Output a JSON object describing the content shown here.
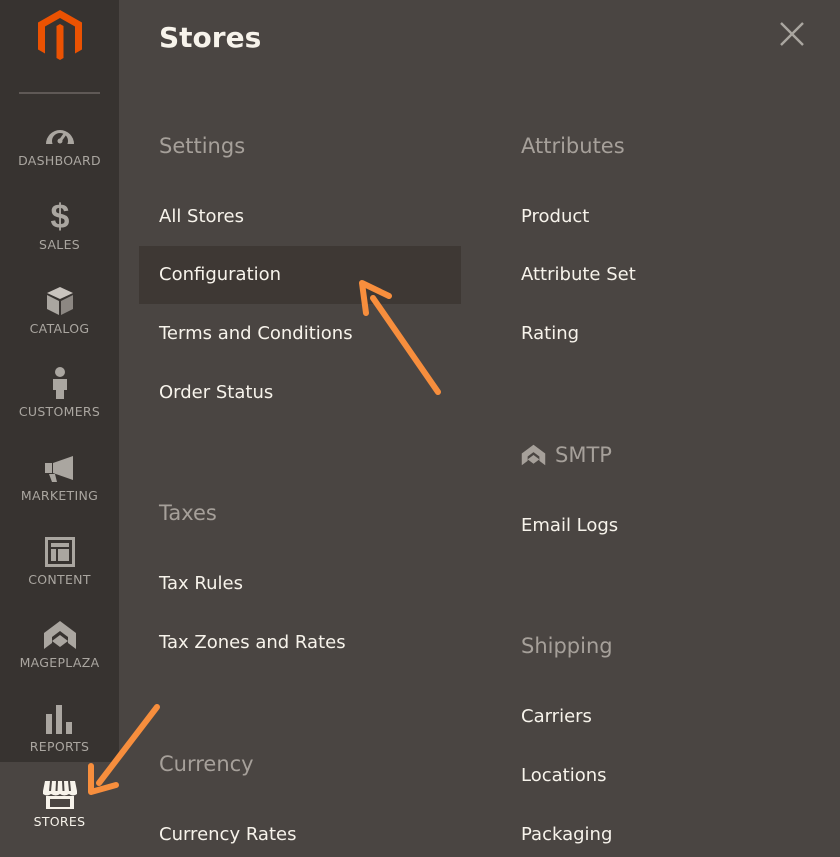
{
  "sidebar": {
    "logo": "magento-logo",
    "items": [
      {
        "label": "DASHBOARD",
        "icon": "gauge-icon"
      },
      {
        "label": "SALES",
        "icon": "dollar-icon"
      },
      {
        "label": "CATALOG",
        "icon": "box-icon"
      },
      {
        "label": "CUSTOMERS",
        "icon": "person-icon"
      },
      {
        "label": "MARKETING",
        "icon": "megaphone-icon"
      },
      {
        "label": "CONTENT",
        "icon": "layout-icon"
      },
      {
        "label": "MAGEPLAZA",
        "icon": "mageplaza-icon"
      },
      {
        "label": "REPORTS",
        "icon": "bar-chart-icon"
      },
      {
        "label": "STORES",
        "icon": "storefront-icon",
        "active": true
      }
    ]
  },
  "panel": {
    "title": "Stores",
    "close_icon": "close-icon",
    "left_column": {
      "settings": {
        "title": "Settings",
        "links": [
          "All Stores",
          "Configuration",
          "Terms and Conditions",
          "Order Status"
        ],
        "highlighted": "Configuration"
      },
      "taxes": {
        "title": "Taxes",
        "links": [
          "Tax Rules",
          "Tax Zones and Rates"
        ]
      },
      "currency": {
        "title": "Currency",
        "links": [
          "Currency Rates"
        ]
      }
    },
    "right_column": {
      "attributes": {
        "title": "Attributes",
        "links": [
          "Product",
          "Attribute Set",
          "Rating"
        ]
      },
      "smtp": {
        "title": "SMTP",
        "icon": "mageplaza-icon",
        "links": [
          "Email Logs"
        ]
      },
      "shipping": {
        "title": "Shipping",
        "links": [
          "Carriers",
          "Locations",
          "Packaging"
        ]
      }
    }
  },
  "colors": {
    "sidebar_bg": "#373330",
    "panel_bg": "#4a4542",
    "highlight_bg": "#3e3834",
    "logo_orange": "#eb5202",
    "annotation_arrow": "#f78e3d",
    "text_primary": "#f7f3eb",
    "text_muted": "#a6a09a"
  }
}
